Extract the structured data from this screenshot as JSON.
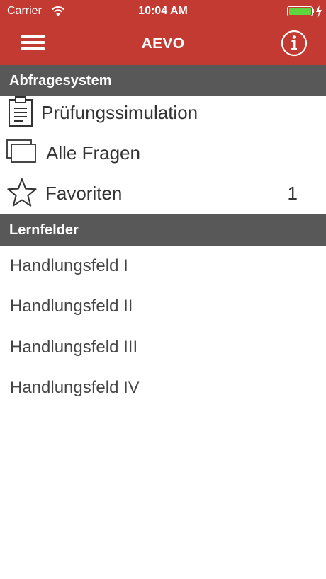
{
  "status_bar": {
    "carrier": "Carrier",
    "time": "10:04 AM",
    "battery_color": "#5fd43f"
  },
  "nav": {
    "title": "AEVO",
    "menu_icon": "hamburger-menu-icon",
    "info_icon": "info-icon",
    "background_color": "#c33a32"
  },
  "section_abfrage": {
    "title": "Abfragesystem",
    "items": [
      {
        "label": "Prüfungssimulation",
        "icon": "clipboard-icon"
      },
      {
        "label": "Alle Fragen",
        "icon": "cards-icon"
      },
      {
        "label": "Favoriten",
        "icon": "star-icon",
        "count": "1"
      }
    ]
  },
  "section_lernfelder": {
    "title": "Lernfelder",
    "items": [
      {
        "label": "Handlungsfeld I"
      },
      {
        "label": "Handlungsfeld II"
      },
      {
        "label": "Handlungsfeld III"
      },
      {
        "label": "Handlungsfeld IV"
      }
    ]
  },
  "colors": {
    "section_header": "#585858",
    "text": "#333333"
  }
}
